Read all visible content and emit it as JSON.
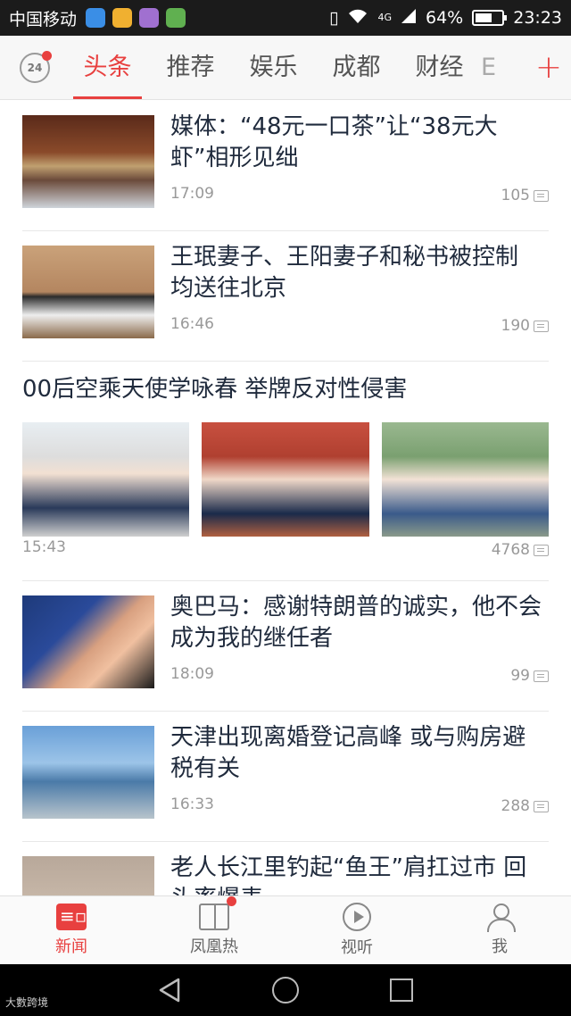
{
  "status_bar": {
    "carrier": "中国移动",
    "network": "4G",
    "battery": "64%",
    "battery_level": 0.64,
    "time": "23:23",
    "app_icon_colors": [
      "#3a8ee6",
      "#f0b030",
      "#a070d0",
      "#60b050"
    ]
  },
  "header": {
    "clock_label": "24",
    "tabs": [
      {
        "label": "头条",
        "active": true
      },
      {
        "label": "推荐",
        "active": false
      },
      {
        "label": "娱乐",
        "active": false
      },
      {
        "label": "成都",
        "active": false
      },
      {
        "label": "财经",
        "active": false
      },
      {
        "label": "E",
        "active": false
      }
    ],
    "add_label": "+"
  },
  "feed": {
    "items": [
      {
        "title": "媒体：“48元一口茶”让“38元大虾”相形见绌",
        "time": "17:09",
        "comments": "105"
      },
      {
        "title": "王珉妻子、王阳妻子和秘书被控制 均送往北京",
        "time": "16:46",
        "comments": "190"
      },
      {
        "title": "00后空乘天使学咏春 举牌反对性侵害",
        "time": "15:43",
        "comments": "4768"
      },
      {
        "title": "奥巴马：感谢特朗普的诚实，他不会成为我的继任者",
        "time": "18:09",
        "comments": "99"
      },
      {
        "title": "天津出现离婚登记高峰 或与购房避税有关",
        "time": "16:33",
        "comments": "288"
      },
      {
        "title": "老人长江里钓起“鱼王”肩扛过市 回头率爆表"
      }
    ]
  },
  "bottom_nav": {
    "items": [
      {
        "label": "新闻",
        "icon": "news-icon",
        "active": true
      },
      {
        "label": "凤凰热",
        "icon": "book-icon",
        "active": false
      },
      {
        "label": "视听",
        "icon": "play-icon",
        "active": false
      },
      {
        "label": "我",
        "icon": "user-icon",
        "active": false
      }
    ]
  },
  "watermark": "大數跨境",
  "colors": {
    "accent": "#e8403f",
    "title_text": "#1f2a3c"
  }
}
